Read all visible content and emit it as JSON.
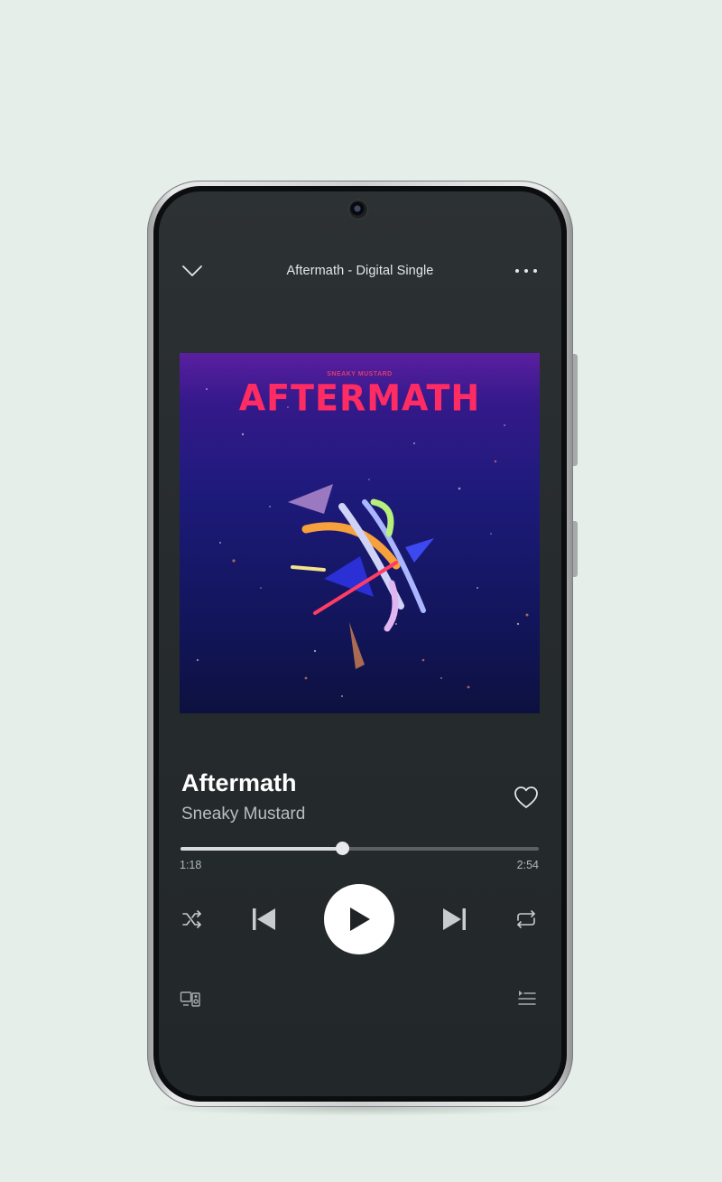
{
  "header": {
    "collapse_icon": "chevron-down-icon",
    "title": "Aftermath - Digital Single",
    "more_icon": "more-horizontal-icon"
  },
  "album_art": {
    "label_small": "SNEAKY MUSTARD",
    "label_title": "AFTERMATH"
  },
  "track": {
    "title": "Aftermath",
    "artist": "Sneaky Mustard",
    "liked": false
  },
  "progress": {
    "elapsed": "1:18",
    "duration": "2:54",
    "fraction": 0.45
  },
  "controls": {
    "shuffle_icon": "shuffle-icon",
    "previous_icon": "skip-previous-icon",
    "play_icon": "play-icon",
    "next_icon": "skip-next-icon",
    "repeat_icon": "repeat-icon"
  },
  "footer": {
    "devices_icon": "connect-devices-icon",
    "queue_icon": "queue-icon"
  },
  "colors": {
    "screen_background": "#262b2d",
    "accent_pink": "#ff2b63",
    "page_background": "#e5eee8"
  }
}
